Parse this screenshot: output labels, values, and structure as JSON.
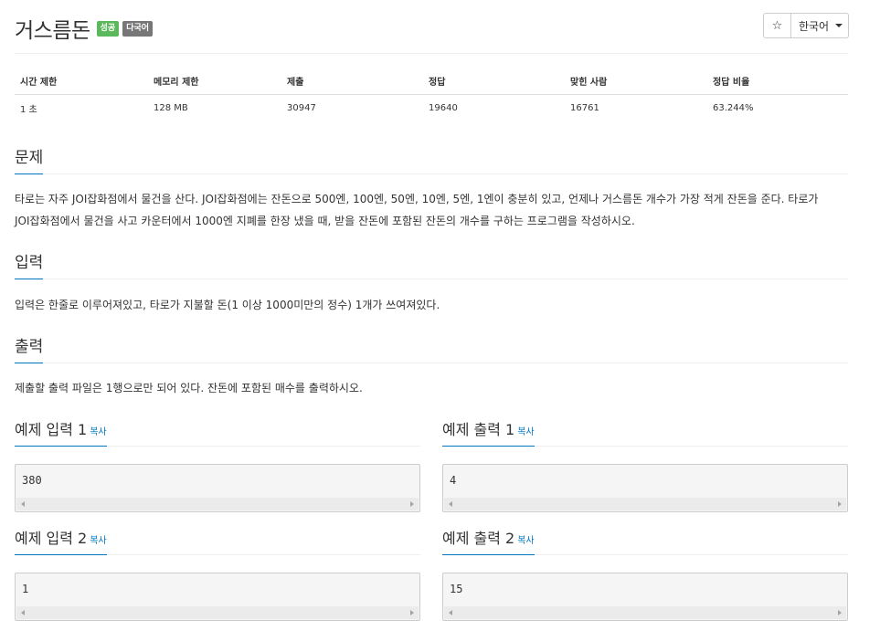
{
  "problem": {
    "title": "거스름돈",
    "badges": {
      "status": "성공",
      "language": "다국어"
    }
  },
  "toolbar": {
    "star_glyph": "☆",
    "language_label": "한국어"
  },
  "info_table": {
    "headers": [
      "시간 제한",
      "메모리 제한",
      "제출",
      "정답",
      "맞힌 사람",
      "정답 비율"
    ],
    "values": [
      "1 초",
      "128 MB",
      "30947",
      "19640",
      "16761",
      "63.244%"
    ]
  },
  "sections": {
    "problem": {
      "heading": "문제",
      "text_line1": "타로는 자주 JOI잡화점에서 물건을 산다. JOI잡화점에는 잔돈으로 500엔, 100엔, 50엔, 10엔, 5엔, 1엔이 충분히 있고, 언제나 거스름돈 개수가 가장 적게 잔돈을 준다. 타로가",
      "text_line2": "JOI잡화점에서 물건을 사고 카운터에서 1000엔 지폐를 한장 냈을 때, 받을 잔돈에 포함된 잔돈의 개수를 구하는 프로그램을 작성하시오."
    },
    "input": {
      "heading": "입력",
      "text": "입력은 한줄로 이루어져있고, 타로가 지불할 돈(1 이상 1000미만의 정수) 1개가 쓰여져있다."
    },
    "output": {
      "heading": "출력",
      "text": "제출할 출력 파일은 1행으로만 되어 있다. 잔돈에 포함된 매수를 출력하시오."
    }
  },
  "samples": {
    "copy_label": "복사",
    "input1": {
      "title": "예제 입력 1",
      "value": "380"
    },
    "output1": {
      "title": "예제 출력 1",
      "value": "4"
    },
    "input2": {
      "title": "예제 입력 2",
      "value": "1"
    },
    "output2": {
      "title": "예제 출력 2",
      "value": "15"
    }
  },
  "colors": {
    "success_badge": "#5cb85c",
    "language_badge": "#777777",
    "accent": "#0076c0"
  }
}
